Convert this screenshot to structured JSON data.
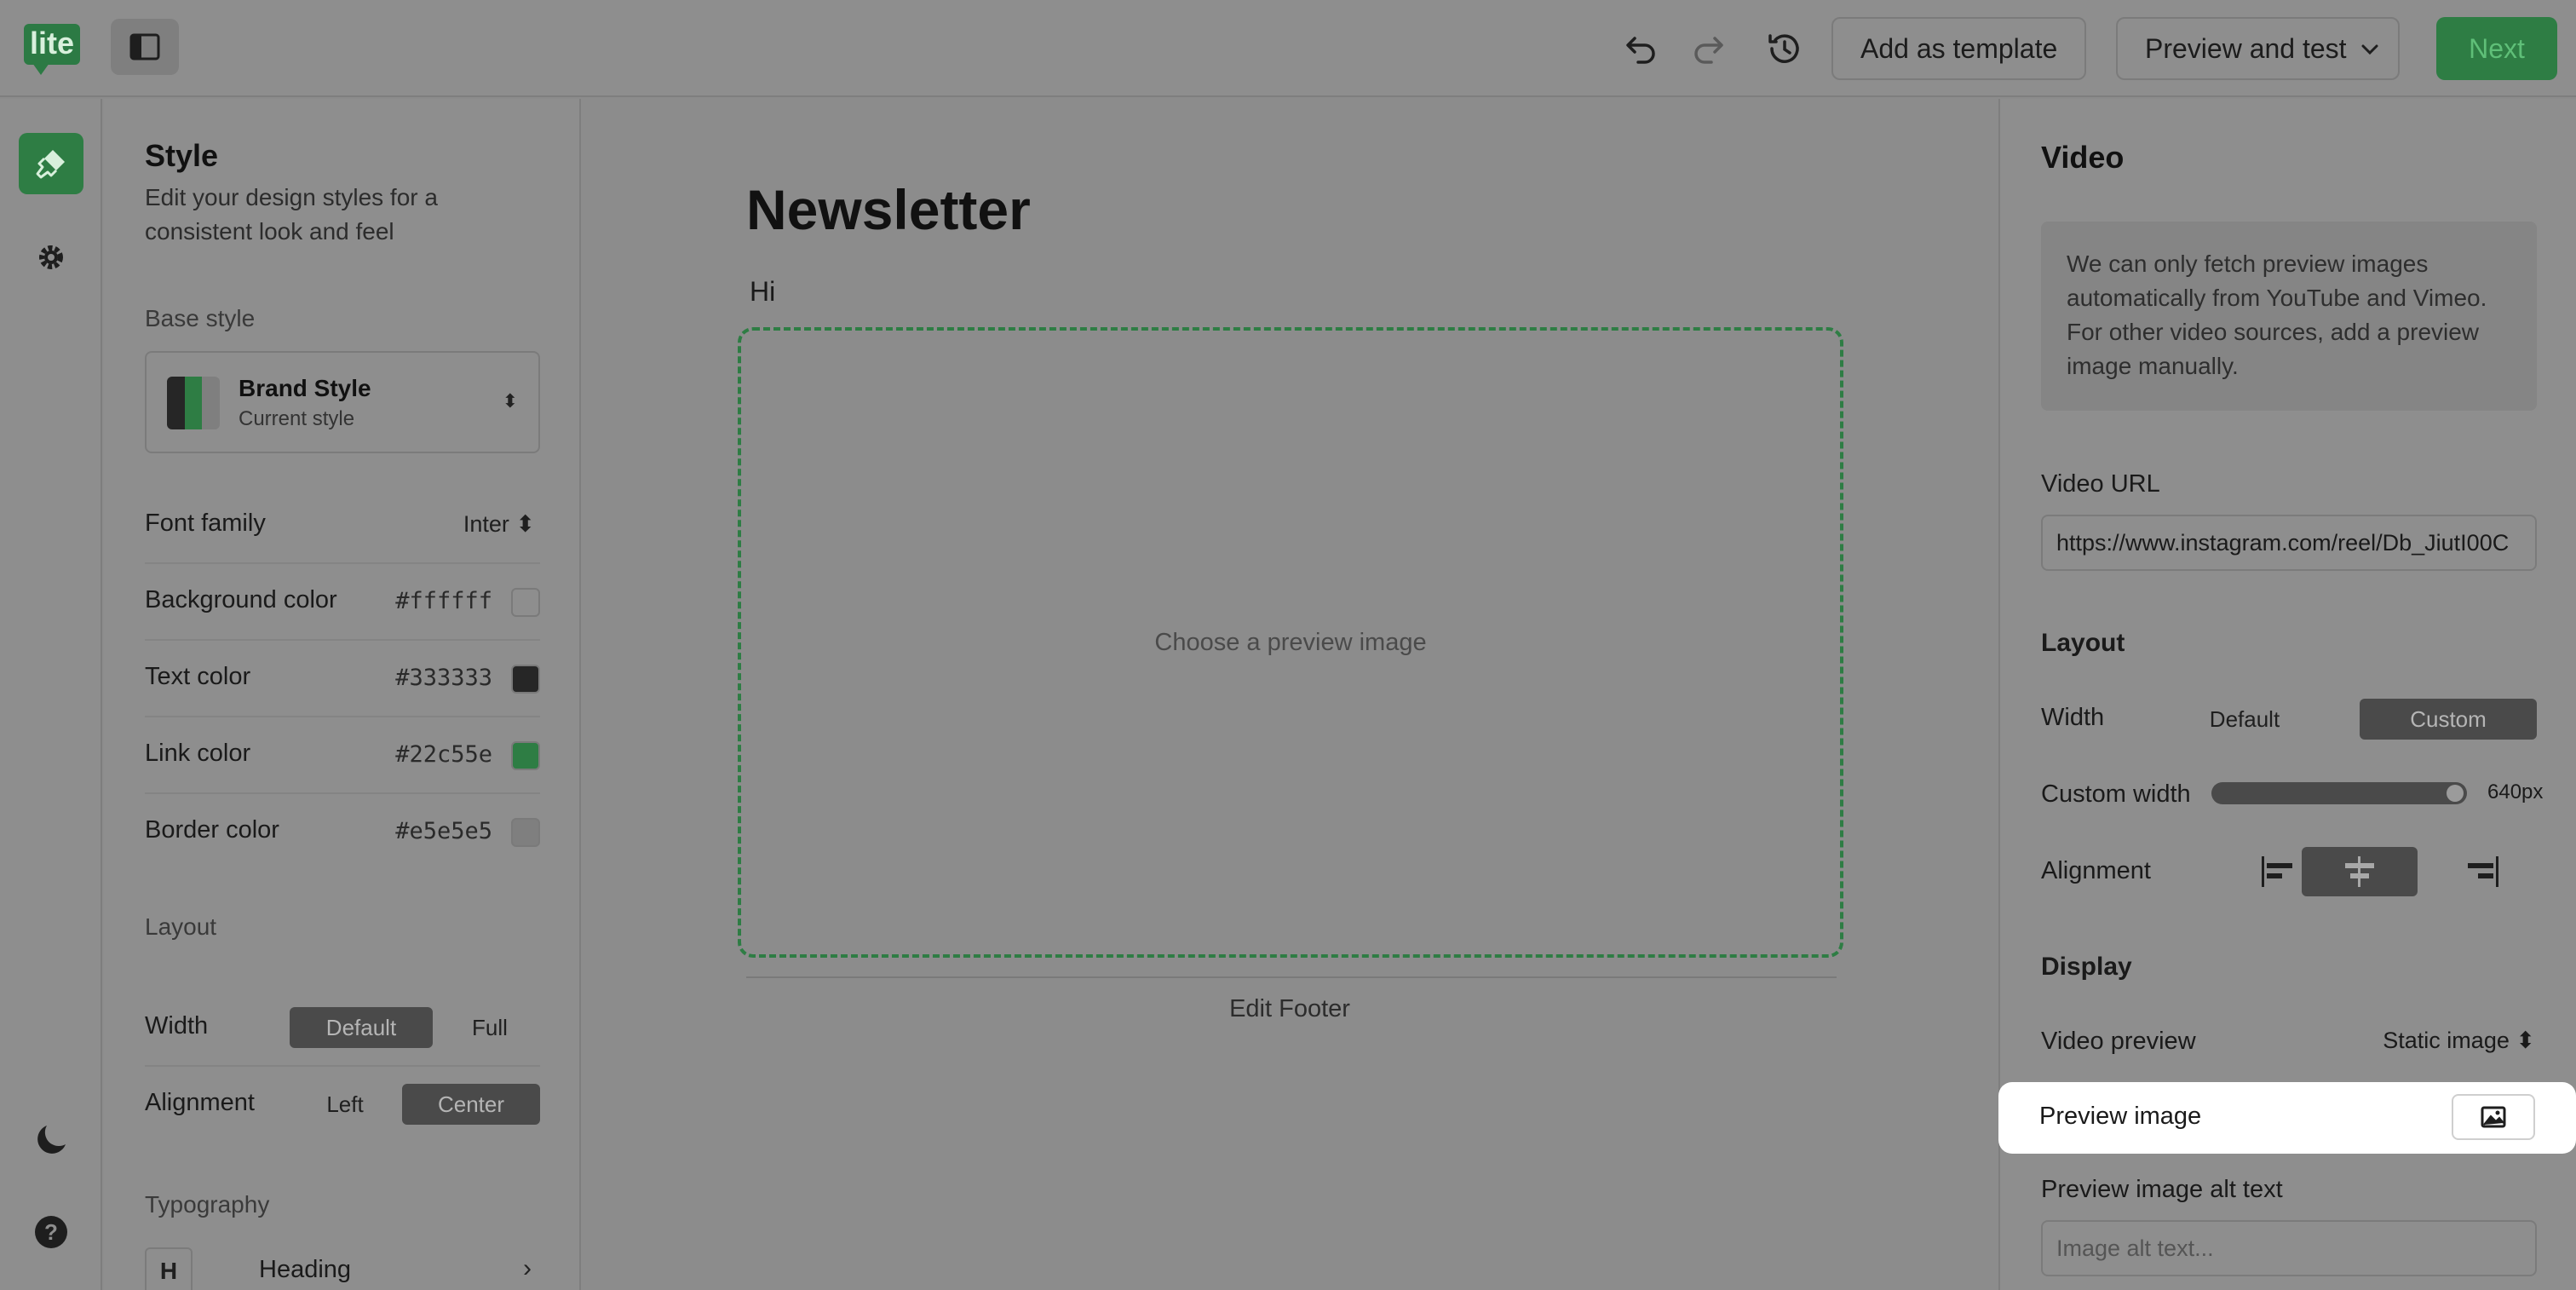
{
  "topbar": {
    "logo_text": "lite",
    "add_template_label": "Add as template",
    "preview_label": "Preview and test",
    "next_label": "Next"
  },
  "left_panel": {
    "title": "Style",
    "description": "Edit your design styles for a consistent look and feel",
    "base_style_label": "Base style",
    "base_style": {
      "name": "Brand Style",
      "subtitle": "Current style"
    },
    "font_family_label": "Font family",
    "font_family_value": "Inter",
    "colors": [
      {
        "label": "Background color",
        "value": "#ffffff"
      },
      {
        "label": "Text color",
        "value": "#333333"
      },
      {
        "label": "Link color",
        "value": "#22c55e"
      },
      {
        "label": "Border color",
        "value": "#e5e5e5"
      }
    ],
    "layout_label": "Layout",
    "width_label": "Width",
    "width_options": [
      "Default",
      "Full"
    ],
    "width_selected": "Default",
    "alignment_label": "Alignment",
    "alignment_options": [
      "Left",
      "Center"
    ],
    "alignment_selected": "Center",
    "typography_label": "Typography",
    "typography_item": {
      "icon_letter": "H",
      "label": "Heading"
    }
  },
  "canvas": {
    "title": "Newsletter",
    "greeting": "Hi",
    "video_placeholder": "Choose a preview image",
    "footer_link": "Edit Footer"
  },
  "right_panel": {
    "title": "Video",
    "note": "We can only fetch preview images automatically from YouTube and Vimeo. For other video sources, add a preview image manually.",
    "video_url_label": "Video URL",
    "video_url_value": "https://www.instagram.com/reel/Db_JiutI00C",
    "layout_label": "Layout",
    "width_label": "Width",
    "width_options": [
      "Default",
      "Custom"
    ],
    "width_selected": "Custom",
    "custom_width_label": "Custom width",
    "custom_width_value": "640px",
    "custom_width_fraction": 1.0,
    "alignment_label": "Alignment",
    "alignment_selected": "center",
    "display_label": "Display",
    "video_preview_label": "Video preview",
    "video_preview_value": "Static image",
    "preview_image_label": "Preview image",
    "alt_text_label": "Preview image alt text",
    "alt_text_placeholder": "Image alt text..."
  },
  "colors": {
    "brand_green": "#2e7d44",
    "swatch_background": "#8e8e8e",
    "swatch_text": "#262626",
    "swatch_link": "#2e7d44",
    "swatch_border": "#7f7f7f"
  }
}
